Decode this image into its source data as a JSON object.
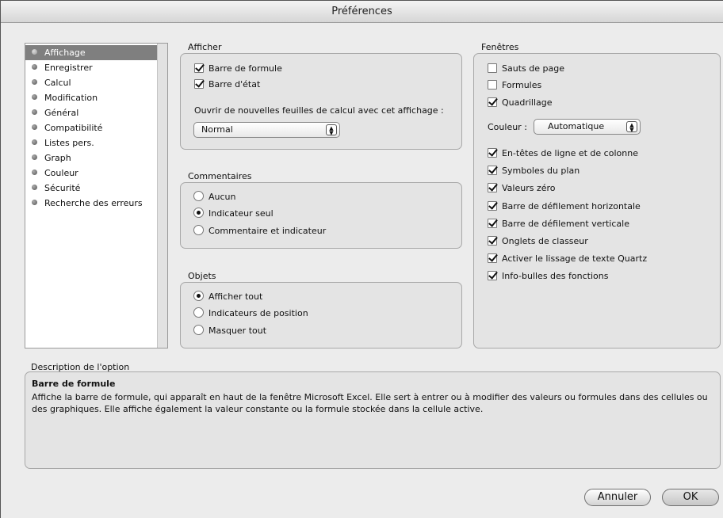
{
  "window": {
    "title": "Préférences"
  },
  "sidebar": {
    "items": [
      {
        "label": "Affichage",
        "selected": true
      },
      {
        "label": "Enregistrer"
      },
      {
        "label": "Calcul"
      },
      {
        "label": "Modification"
      },
      {
        "label": "Général"
      },
      {
        "label": "Compatibilité"
      },
      {
        "label": "Listes pers."
      },
      {
        "label": "Graph"
      },
      {
        "label": "Couleur"
      },
      {
        "label": "Sécurité"
      },
      {
        "label": "Recherche des erreurs"
      }
    ]
  },
  "afficher": {
    "title": "Afficher",
    "formula_bar": {
      "label": "Barre de formule",
      "checked": true
    },
    "status_bar": {
      "label": "Barre d'état",
      "checked": true
    },
    "open_label": "Ouvrir de nouvelles feuilles de calcul avec cet affichage :",
    "view_select": "Normal"
  },
  "commentaires": {
    "title": "Commentaires",
    "options": [
      {
        "label": "Aucun",
        "selected": false
      },
      {
        "label": "Indicateur seul",
        "selected": true
      },
      {
        "label": "Commentaire et indicateur",
        "selected": false
      }
    ]
  },
  "objets": {
    "title": "Objets",
    "options": [
      {
        "label": "Afficher tout",
        "selected": true
      },
      {
        "label": "Indicateurs de position",
        "selected": false
      },
      {
        "label": "Masquer tout",
        "selected": false
      }
    ]
  },
  "fenetres": {
    "title": "Fenêtres",
    "top_options": [
      {
        "label": "Sauts de page",
        "checked": false
      },
      {
        "label": "Formules",
        "checked": false
      },
      {
        "label": "Quadrillage",
        "checked": true
      }
    ],
    "color_label": "Couleur :",
    "color_select": "Automatique",
    "bottom_options": [
      {
        "label": "En-têtes de ligne et de colonne",
        "checked": true
      },
      {
        "label": "Symboles du plan",
        "checked": true
      },
      {
        "label": "Valeurs zéro",
        "checked": true
      },
      {
        "label": "Barre de défilement horizontale",
        "checked": true
      },
      {
        "label": "Barre de défilement verticale",
        "checked": true
      },
      {
        "label": "Onglets de classeur",
        "checked": true
      },
      {
        "label": "Activer le lissage de texte Quartz",
        "checked": true
      },
      {
        "label": "Info-bulles des fonctions",
        "checked": true
      }
    ]
  },
  "description": {
    "label": "Description de l'option",
    "title": "Barre de formule",
    "body": "Affiche la barre de formule, qui apparaît en haut de la fenêtre Microsoft Excel. Elle sert à entrer ou à modifier des valeurs ou formules dans des cellules ou des graphiques. Elle affiche également la valeur constante ou la formule stockée dans la cellule active."
  },
  "buttons": {
    "cancel": "Annuler",
    "ok": "OK"
  }
}
